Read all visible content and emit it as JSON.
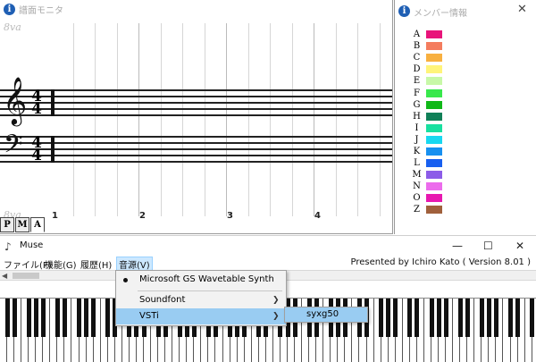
{
  "score_window": {
    "title": "譜面モニタ",
    "ottava_top": "8va",
    "ottava_bottom": "8va",
    "measures": [
      "1",
      "2",
      "3",
      "4"
    ],
    "time_sig_top": {
      "num": "4",
      "den": "4"
    },
    "time_sig_bottom": {
      "num": "4",
      "den": "4"
    },
    "clef_treble": "𝄞",
    "clef_bass": "𝄢",
    "tabs": [
      "P",
      "M",
      "A"
    ]
  },
  "member_window": {
    "title": "メンバー情報",
    "close": "✕",
    "members": [
      {
        "letter": "A",
        "color": "#e8147a"
      },
      {
        "letter": "B",
        "color": "#f47c5e"
      },
      {
        "letter": "C",
        "color": "#f8b040"
      },
      {
        "letter": "D",
        "color": "#fff47a"
      },
      {
        "letter": "E",
        "color": "#c8f8a8"
      },
      {
        "letter": "F",
        "color": "#38e84c"
      },
      {
        "letter": "G",
        "color": "#10b818"
      },
      {
        "letter": "H",
        "color": "#108058"
      },
      {
        "letter": "I",
        "color": "#18e0a0"
      },
      {
        "letter": "J",
        "color": "#18d8f0"
      },
      {
        "letter": "K",
        "color": "#1890f0"
      },
      {
        "letter": "L",
        "color": "#1860f0"
      },
      {
        "letter": "M",
        "color": "#8c5ce8"
      },
      {
        "letter": "N",
        "color": "#ec6cec"
      },
      {
        "letter": "O",
        "color": "#e818b0"
      },
      {
        "letter": "Z",
        "color": "#a0603c"
      }
    ]
  },
  "muse_window": {
    "title": "Muse",
    "minimize": "—",
    "maximize": "☐",
    "close": "✕",
    "menu": [
      "ファイル(F)",
      "機能(G)",
      "履歴(H)",
      "音源(V)"
    ],
    "credit": "Presented by Ichiro Kato ( Version 8.01 )"
  },
  "source_menu": {
    "items": [
      {
        "label": "Microsoft GS Wavetable Synth",
        "selected": true
      },
      {
        "label": "Soundfont"
      },
      {
        "label": "VSTi",
        "highlighted": true
      }
    ],
    "vsti_submenu": [
      "syxg50"
    ]
  },
  "colors": {
    "menu_highlight": "#99ccf2",
    "info_icon": "#1f5fb4"
  }
}
